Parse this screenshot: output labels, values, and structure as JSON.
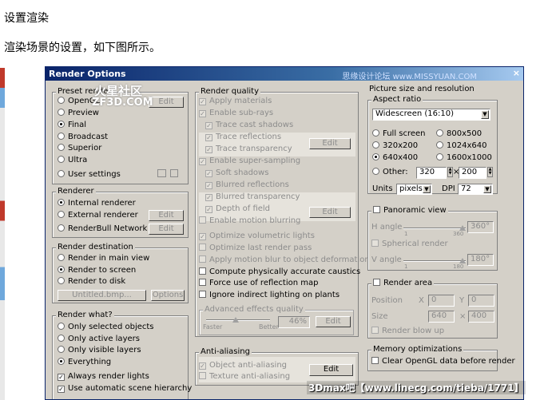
{
  "page": {
    "heading": "设置渲染",
    "description": "渲染场景的设置，如下图所示。"
  },
  "window": {
    "title": "Render Options",
    "close": "×",
    "watermark": "思缘设计论坛 www.MISSYUAN.COM"
  },
  "watermarks": {
    "logo_line1": "火星社区",
    "logo_line2": "ZF3D.COM",
    "bottom": "3Dmax吧【www.linecg.com/tieba/1771】"
  },
  "preset": {
    "title": "Preset render",
    "items": [
      "OpenGL",
      "Preview",
      "Final",
      "Broadcast",
      "Superior",
      "Ultra",
      "User settings"
    ],
    "selected": "Final",
    "edit": "Edit"
  },
  "renderer": {
    "title": "Renderer",
    "items": [
      "Internal renderer",
      "External renderer",
      "RenderBull Network"
    ],
    "selected": "Internal renderer",
    "edit": "Edit"
  },
  "destination": {
    "title": "Render destination",
    "items": [
      "Render in main view",
      "Render to screen",
      "Render to disk"
    ],
    "selected": "Render to screen",
    "file": "Untitled.bmp...",
    "options": "Options"
  },
  "what": {
    "title": "Render what?",
    "items": [
      "Only selected objects",
      "Only active layers",
      "Only visible layers",
      "Everything"
    ],
    "selected": "Everything",
    "checks": [
      "Always render lights",
      "Use automatic scene hierarchy"
    ]
  },
  "quality": {
    "title": "Render quality",
    "items": [
      "Apply materials",
      "Enable sub-rays",
      "Trace cast shadows",
      "Trace reflections",
      "Trace transparency",
      "Enable super-sampling",
      "Soft shadows",
      "Blurred reflections",
      "Blurred transparency",
      "Depth of field",
      "Enable motion blurring",
      "Optimize volumetric lights",
      "Optimize last render pass",
      "Apply motion blur to object deformation",
      "Compute physically accurate caustics",
      "Force use of reflection map",
      "Ignore indirect lighting on plants"
    ],
    "edit": "Edit"
  },
  "advanced": {
    "title": "Advanced effects quality",
    "faster": "Faster",
    "better": "Better",
    "value": "46%",
    "level": 0.46,
    "edit": "Edit"
  },
  "antialias": {
    "title": "Anti-aliasing",
    "items": [
      "Object anti-aliasing",
      "Texture anti-aliasing"
    ],
    "edit": "Edit"
  },
  "picture": {
    "title": "Picture size and resolution",
    "aspect_title": "Aspect ratio",
    "aspect_value": "Widescreen (16:10)",
    "sizes": [
      "Full screen",
      "800x500",
      "320x200",
      "1024x640",
      "640x400",
      "1600x1000"
    ],
    "selected": "640x400",
    "other": "Other:",
    "other_w": "320",
    "other_h": "200",
    "times": "×",
    "units_label": "Units",
    "units_value": "pixels",
    "dpi_label": "DPI",
    "dpi_value": "72"
  },
  "panoramic": {
    "title": "Panoramic view",
    "h_angle": "H angle",
    "h_value": "360°",
    "h_max": "360",
    "h_min": "1",
    "spherical": "Spherical render",
    "v_angle": "V angle",
    "v_value": "180°",
    "v_max": "180",
    "v_min": "1"
  },
  "area": {
    "title": "Render area",
    "position": "Position",
    "x": "X",
    "x_val": "0",
    "y": "Y",
    "y_val": "0",
    "size": "Size",
    "w_val": "640",
    "times": "×",
    "h_val": "400",
    "blowup": "Render blow up"
  },
  "memory": {
    "title": "Memory optimizations",
    "clear": "Clear OpenGL data before render"
  }
}
